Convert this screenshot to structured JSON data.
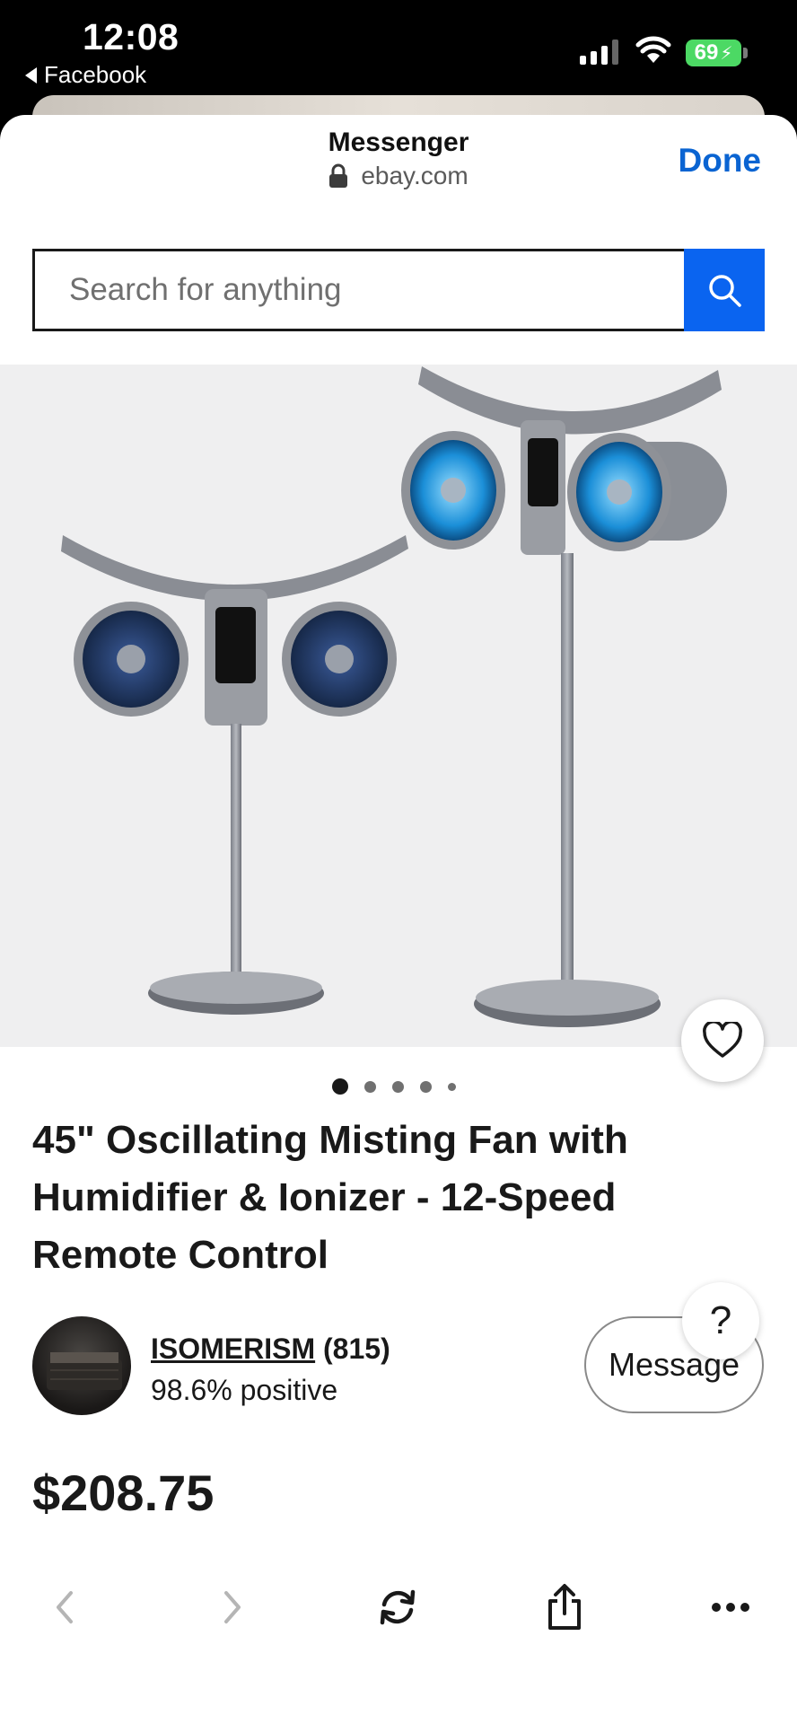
{
  "status_bar": {
    "time": "12:08",
    "back_app": "Facebook",
    "battery": "69"
  },
  "sheet": {
    "title": "Messenger",
    "url": "ebay.com",
    "done_label": "Done"
  },
  "search": {
    "placeholder": "Search for anything"
  },
  "gallery": {
    "image_count": 5,
    "active_index": 0
  },
  "product": {
    "title": "45\" Oscillating Misting Fan with Humidifier & Ionizer - 12-Speed Remote Control",
    "price": "$208.75"
  },
  "seller": {
    "name": "ISOMERISM",
    "feedback_count": "(815)",
    "positive": "98.6% positive",
    "message_label": "Message"
  },
  "help": {
    "label": "?"
  },
  "colors": {
    "ebay_blue": "#0a64f0",
    "done_blue": "#0a64d2",
    "battery_green": "#4cd964"
  },
  "toolbar": {
    "icons": [
      "back-icon",
      "forward-icon",
      "reload-icon",
      "share-icon",
      "more-icon"
    ]
  }
}
